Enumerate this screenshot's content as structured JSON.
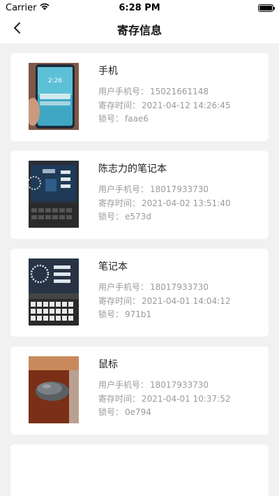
{
  "status": {
    "carrier": "Carrier",
    "time": "6:28 PM"
  },
  "nav": {
    "title": "寄存信息"
  },
  "labels": {
    "phone": "用户手机号：",
    "time": "寄存时间：",
    "lock": "锁号："
  },
  "items": [
    {
      "name": "手机",
      "phone": "15021661148",
      "time": "2021-04-12 14:26:45",
      "lock": "faae6",
      "image": "phone-photo"
    },
    {
      "name": "陈志力的笔记本",
      "phone": "18017933730",
      "time": "2021-04-02 13:51:40",
      "lock": "e573d",
      "image": "laptop-photo"
    },
    {
      "name": "笔记本",
      "phone": "18017933730",
      "time": "2021-04-01 14:04:12",
      "lock": "971b1",
      "image": "laptop-photo"
    },
    {
      "name": "鼠标",
      "phone": "18017933730",
      "time": "2021-04-01 10:37:52",
      "lock": "0e794",
      "image": "mouse-photo"
    }
  ],
  "icons": {
    "back": "chevron-left-icon",
    "wifi": "wifi-icon",
    "battery": "battery-icon"
  }
}
